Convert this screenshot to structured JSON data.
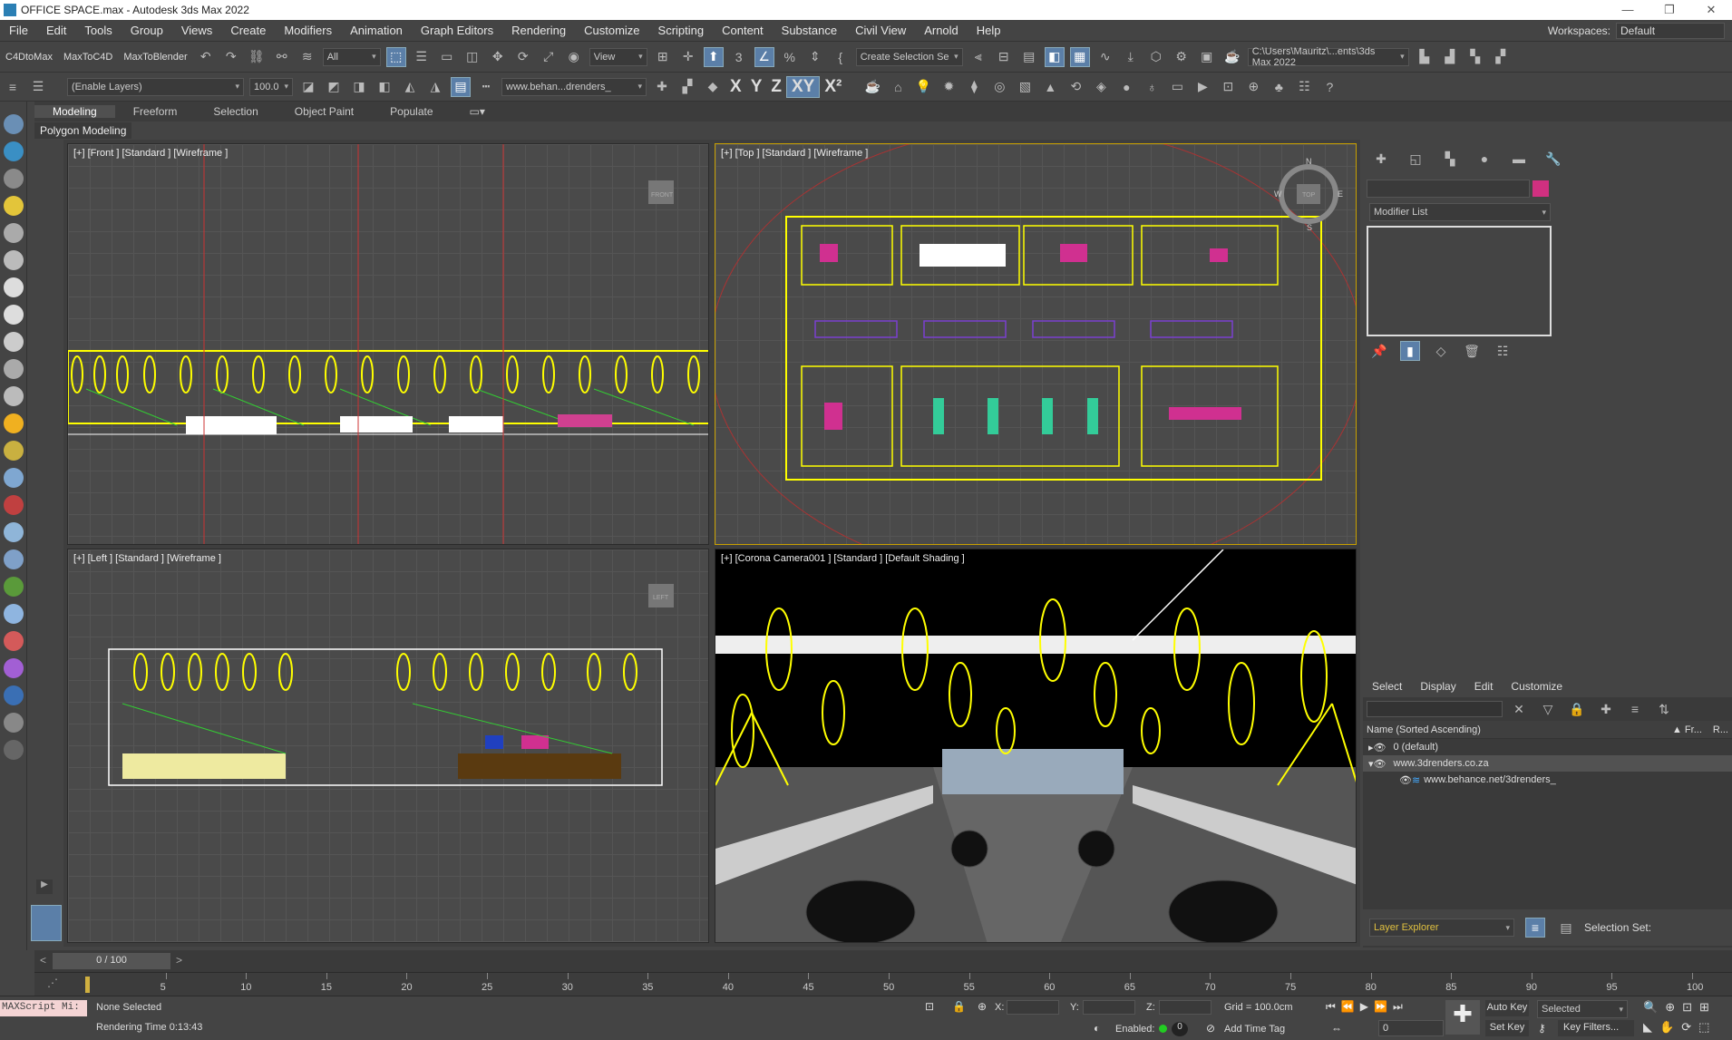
{
  "titlebar": {
    "title": "OFFICE SPACE.max - Autodesk 3ds Max 2022"
  },
  "menu": {
    "items": [
      "File",
      "Edit",
      "Tools",
      "Group",
      "Views",
      "Create",
      "Modifiers",
      "Animation",
      "Graph Editors",
      "Rendering",
      "Customize",
      "Scripting",
      "Content",
      "Substance",
      "Civil View",
      "Arnold",
      "Help"
    ],
    "workspaces_label": "Workspaces:",
    "workspaces_value": "Default"
  },
  "toolbar1": {
    "plugins": [
      "C4DtoMax",
      "MaxToC4D",
      "MaxToBlender"
    ],
    "selection_filter": "All",
    "ref_coord": "View",
    "named_selection": "Create Selection Se",
    "project_path": "C:\\Users\\Mauritz\\...ents\\3ds Max 2022"
  },
  "toolbar2": {
    "layer_field": "(Enable Layers)",
    "layer_value": "100.0",
    "layer_name": "www.behan...drenders_",
    "axes": [
      "X",
      "Y",
      "Z",
      "XY",
      "X²"
    ]
  },
  "ribbon": {
    "tabs": [
      "Modeling",
      "Freeform",
      "Selection",
      "Object Paint",
      "Populate"
    ],
    "sub": "Polygon Modeling"
  },
  "viewports": {
    "front": "[+] [Front ] [Standard ] [Wireframe ]",
    "top": "[+] [Top ] [Standard ] [Wireframe ]",
    "left": "[+] [Left ] [Standard ] [Wireframe ]",
    "camera": "[+] [Corona Camera001 ] [Standard ] [Default Shading ]"
  },
  "viewcube": {
    "front": "FRONT",
    "top": "TOP",
    "left": "LEFT",
    "n": "N",
    "s": "S",
    "e": "E",
    "w": "W"
  },
  "modify_panel": {
    "modifier_list": "Modifier List"
  },
  "layer_explorer": {
    "tabs": [
      "Select",
      "Display",
      "Edit",
      "Customize"
    ],
    "header": "Name (Sorted Ascending)",
    "col_fr": "▲ Fr...",
    "col_r": "R...",
    "rows": [
      "0 (default)",
      "www.3drenders.co.za",
      "www.behance.net/3drenders_"
    ],
    "footer_label": "Layer Explorer",
    "selection_set": "Selection Set:"
  },
  "timeline": {
    "frame": "0 / 100",
    "ticks": [
      "5",
      "10",
      "15",
      "20",
      "25",
      "30",
      "35",
      "40",
      "45",
      "50",
      "55",
      "60",
      "65",
      "70",
      "75",
      "80",
      "85",
      "90",
      "95",
      "100"
    ]
  },
  "status": {
    "script": "MAXScript Mi:",
    "selection": "None Selected",
    "render_time": "Rendering Time  0:13:43",
    "x_label": "X:",
    "y_label": "Y:",
    "z_label": "Z:",
    "grid": "Grid = 100.0cm",
    "enabled": "Enabled:",
    "enabled_value": "0",
    "add_time_tag": "Add Time Tag",
    "auto_key": "Auto Key",
    "set_key": "Set Key",
    "key_mode": "Selected",
    "key_filters": "Key Filters...",
    "frame_value": "0"
  }
}
